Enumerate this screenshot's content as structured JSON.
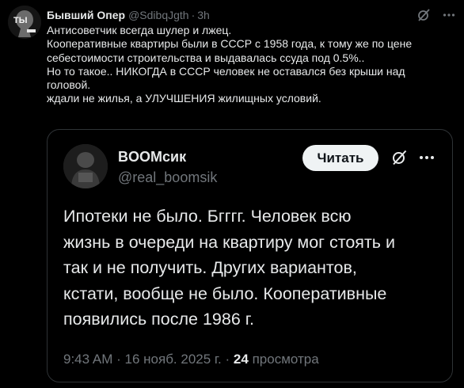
{
  "post": {
    "author_name": "Бывший Опер",
    "author_handle": "@SdibqJgth",
    "separator": "·",
    "time": "3h",
    "avatar_text": "ТЫ",
    "lines": [
      "Антисоветчик всегда шулер и лжец.",
      "Кооперативные квартиры были в СССР с 1958 года, к тому же по цене",
      "себестоимости строительства и выдавалась ссуда под 0.5%..",
      "Но то такое.. НИКОГДА в СССР человек не оставался без крыши над",
      "головой.",
      "ждали не жилья, а УЛУЧШЕНИЯ жилищных условий."
    ]
  },
  "quote": {
    "author_name": "BOOMсик",
    "author_handle": "@real_boomsik",
    "follow_label": "Читать",
    "body_lines": [
      "Ипотеки не было. Бгггг. Человек всю",
      "жизнь в очереди на квартиру мог стоять и",
      "так и не получить. Других вариантов,",
      "кстати, вообще не было. Кооперативные",
      "появились после 1986 г."
    ],
    "meta_time": "9:43 AM",
    "meta_sep1": "·",
    "meta_date": "16 нояб. 2025 г.",
    "meta_sep2": "·",
    "views_count": "24",
    "views_label": "просмотра"
  },
  "colors": {
    "background": "#000000",
    "text_primary": "#e7e9ea",
    "text_secondary": "#71767b",
    "border": "#2f3336",
    "button_bg": "#eff3f4"
  },
  "icons": [
    "grok-icon",
    "more-icon"
  ]
}
